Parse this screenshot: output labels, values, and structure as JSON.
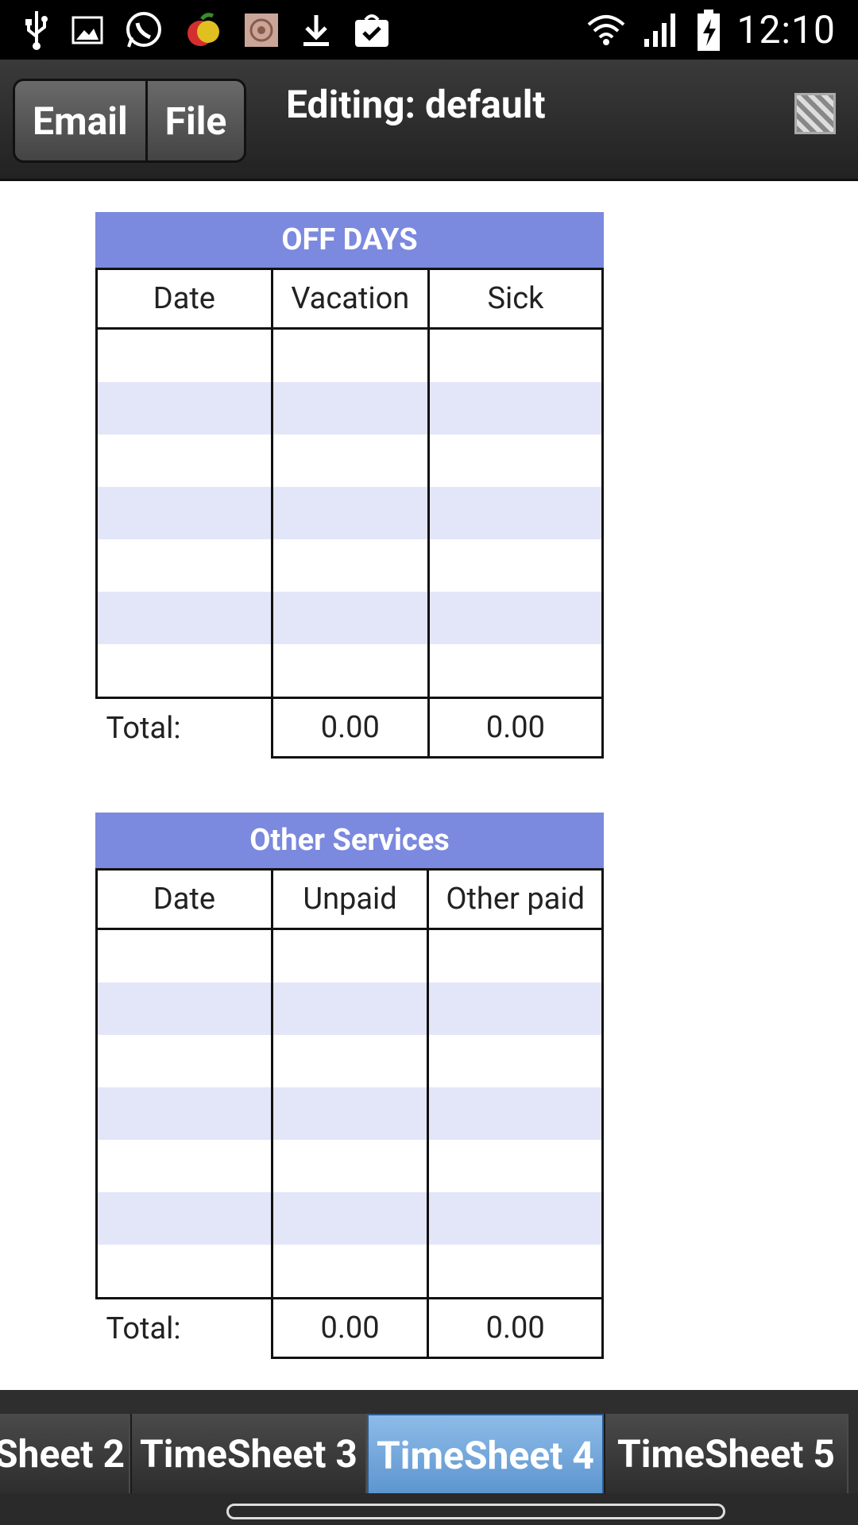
{
  "status_bar": {
    "time": "12:10",
    "icons": [
      "usb-icon",
      "image-icon",
      "whatsapp-icon",
      "fruit-app-icon",
      "app-icon",
      "download-icon",
      "shopping-bag-icon",
      "wifi-icon",
      "signal-icon",
      "battery-charging-icon"
    ]
  },
  "action_bar": {
    "email_label": "Email",
    "file_label": "File",
    "title": "Editing: default",
    "qr_icon": "qr-code-icon"
  },
  "off_days": {
    "title": "OFF DAYS",
    "headers": [
      "Date",
      "Vacation",
      "Sick"
    ],
    "total_label": "Total:",
    "total_vacation": "0.00",
    "total_sick": "0.00"
  },
  "other_services": {
    "title": "Other Services",
    "headers": [
      "Date",
      "Unpaid",
      "Other paid"
    ],
    "total_label": "Total:",
    "total_unpaid": "0.00",
    "total_other_paid": "0.00"
  },
  "tabs": [
    {
      "label": "Sheet 2",
      "active": false
    },
    {
      "label": "TimeSheet 3",
      "active": false
    },
    {
      "label": "TimeSheet 4",
      "active": true
    },
    {
      "label": "TimeSheet 5",
      "active": false
    }
  ],
  "colors": {
    "table_header": "#7b89de",
    "alt_row": "#e3e5f8",
    "active_tab": "#6fa6dc"
  }
}
